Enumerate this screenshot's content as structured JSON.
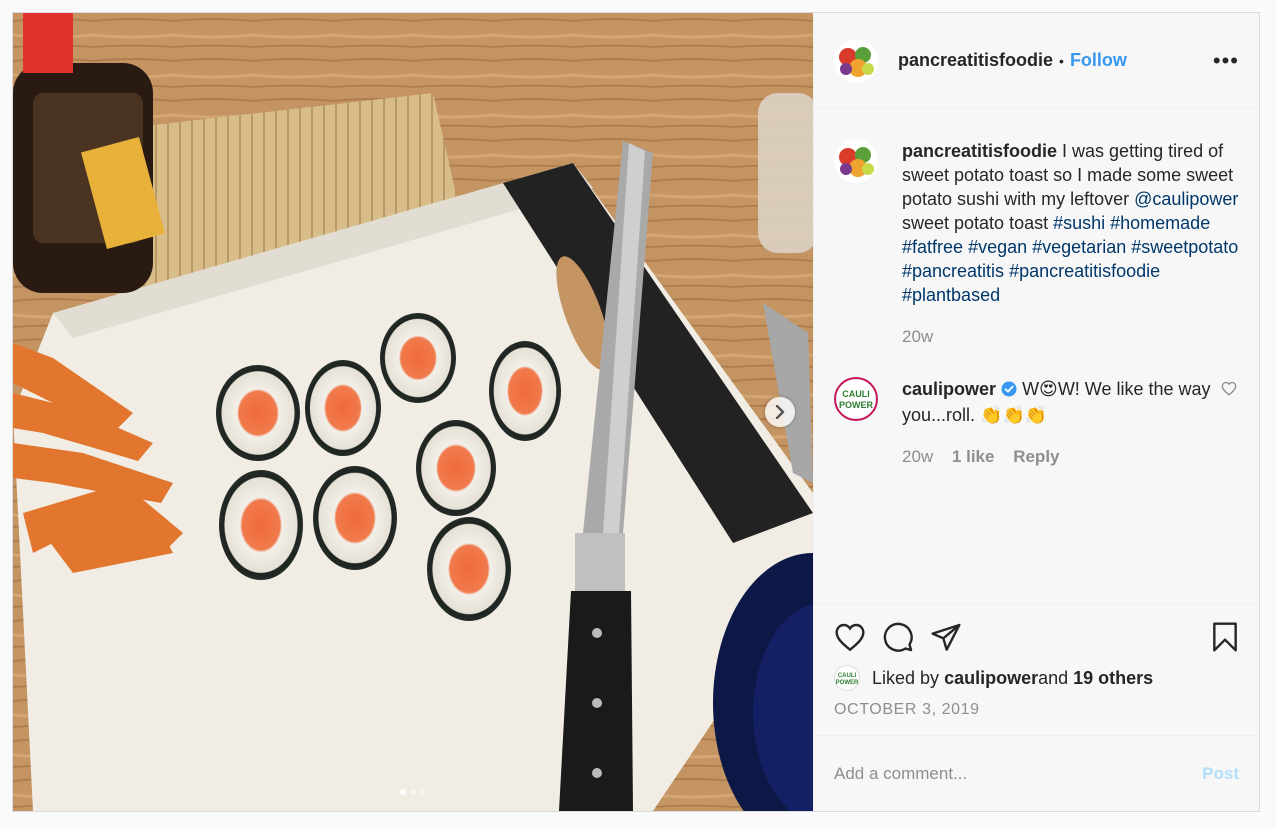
{
  "post": {
    "author": "pancreatitisfoodie",
    "separator": "•",
    "follow_label": "Follow",
    "more_icon": "more-options-icon",
    "more_label": "•••",
    "image": {
      "slide_count": 3,
      "active_slide": 1,
      "next_icon": "chevron-right-icon"
    }
  },
  "caption": {
    "user": "pancreatitisfoodie",
    "text_before": " I was getting tired of sweet potato toast so I made some sweet potato sushi with my leftover ",
    "mention": "@caulipower",
    "text_after": " sweet potato toast ",
    "hashtags": [
      "#sushi",
      "#homemade",
      "#fatfree",
      "#vegan",
      "#vegetarian",
      "#sweetpotato",
      "#pancreatitis",
      "#pancreatitisfoodie",
      "#plantbased"
    ],
    "time": "20w"
  },
  "reply": {
    "user": "caulipower",
    "avatar_text_1": "CAULI",
    "avatar_text_2": "POWER",
    "verified_icon": "verified-badge-icon",
    "text": "W😍W! We like the way you...roll. 👏👏👏",
    "time": "20w",
    "likes": "1 like",
    "reply_label": "Reply",
    "heart_icon": "heart-outline-icon"
  },
  "actions": {
    "like_icon": "heart-icon",
    "comment_icon": "comment-icon",
    "share_icon": "share-icon",
    "save_icon": "bookmark-icon"
  },
  "likes": {
    "prefix": "Liked by ",
    "user": "caulipower",
    "middle": " and ",
    "others": "19 others"
  },
  "date": "OCTOBER 3, 2019",
  "add_comment": {
    "placeholder": "Add a comment...",
    "post_label": "Post"
  },
  "colors": {
    "link": "#00376b",
    "follow": "#3897f0",
    "post_disabled": "#b2dffc",
    "verified": "#3897f0"
  }
}
